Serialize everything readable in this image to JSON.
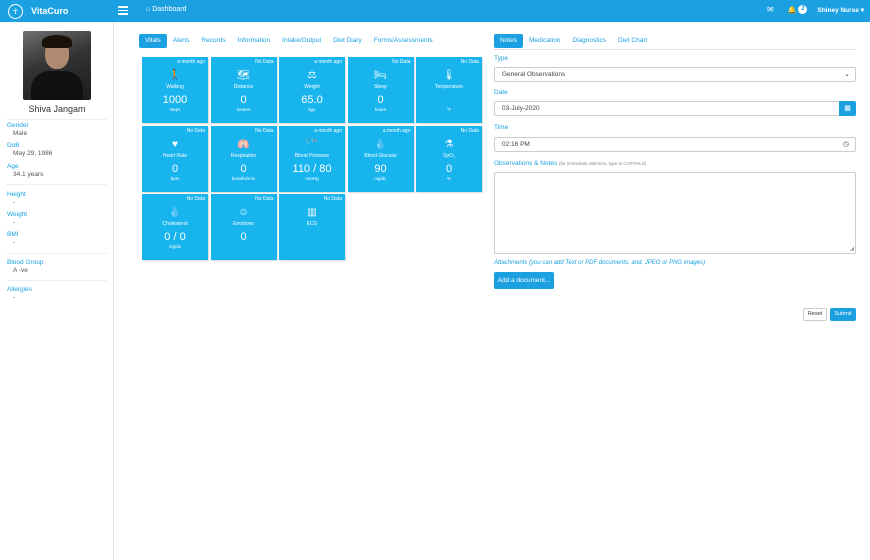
{
  "app": {
    "name": "VitaCuro",
    "logo": "vitacuro-logo-icon"
  },
  "header": {
    "breadcrumb": "Dashboard",
    "notification_count": "2",
    "user": "Shiney Nurse",
    "user_caret": "▾",
    "accent_color": "#1ba1e2"
  },
  "patient": {
    "name": "Shiva Jangam",
    "fields": {
      "gender": {
        "label": "Gender",
        "value": "Male"
      },
      "dob": {
        "label": "DoB",
        "value": "May 29, 1986"
      },
      "age": {
        "label": "Age",
        "value": "34.1 years"
      },
      "height": {
        "label": "Height",
        "value": "-"
      },
      "weight": {
        "label": "Weight",
        "value": "-"
      },
      "bmi": {
        "label": "BMI",
        "value": "-"
      },
      "blood_group": {
        "label": "Blood Group",
        "value": "A -ve"
      },
      "allergies": {
        "label": "Allergies",
        "value": "-"
      }
    }
  },
  "left_tabs": [
    "Vitals",
    "Alerts",
    "Records",
    "Information",
    "Intake/Output",
    "Diet Diary",
    "Forms/Assessments"
  ],
  "tiles": [
    {
      "ago": "a month ago",
      "icon": "walking-icon",
      "glyph": "🚶",
      "name": "Walking",
      "value": "1000",
      "unit": "steps"
    },
    {
      "ago": "No Data",
      "icon": "map-icon",
      "glyph": "🗺",
      "name": "Distance",
      "value": "0",
      "unit": "meters"
    },
    {
      "ago": "a month ago",
      "icon": "weight-icon",
      "glyph": "⚖",
      "name": "Weight",
      "value": "65.0",
      "unit": "kgs"
    },
    {
      "ago": "No Data",
      "icon": "bed-icon",
      "glyph": "🛏",
      "name": "Sleep",
      "value": "0",
      "unit": "hours"
    },
    {
      "ago": "No Data",
      "icon": "thermometer-icon",
      "glyph": "🌡",
      "name": "Temperature",
      "value": "",
      "unit": "°F"
    },
    {
      "ago": "No Data",
      "icon": "heartbeat-icon",
      "glyph": "♥",
      "name": "Heart Rate",
      "value": "0",
      "unit": "bpm"
    },
    {
      "ago": "No Data",
      "icon": "lungs-icon",
      "glyph": "🫁",
      "name": "Respiration",
      "value": "0",
      "unit": "breaths/min"
    },
    {
      "ago": "a month ago",
      "icon": "stethoscope-icon",
      "glyph": "🩺",
      "name": "Blood Pressure",
      "value": "110 / 80",
      "unit": "mmHg"
    },
    {
      "ago": "a month ago",
      "icon": "drop-icon",
      "glyph": "💧",
      "name": "Blood Glucose",
      "value": "90",
      "unit": "mg/dL"
    },
    {
      "ago": "No Data",
      "icon": "oxygen-icon",
      "glyph": "⚗",
      "name": "SpO₂",
      "value": "0",
      "unit": "%"
    },
    {
      "ago": "No Data",
      "icon": "drop-icon",
      "glyph": "💧",
      "name": "Cholesterol",
      "value": "0 / 0",
      "unit": "mg/dL"
    },
    {
      "ago": "No Data",
      "icon": "smile-icon",
      "glyph": "☺",
      "name": "Emotions",
      "value": "0",
      "unit": ""
    },
    {
      "ago": "No Data",
      "icon": "barcode-icon",
      "glyph": "▥",
      "name": "ECG",
      "value": "",
      "unit": ""
    }
  ],
  "right_tabs": [
    "Notes",
    "Medication",
    "Diagnostics",
    "Diet Chart"
  ],
  "form": {
    "type_label": "Type",
    "type_value": "General Observations",
    "date_label": "Date",
    "date_value": "03-July-2020",
    "time_label": "Time",
    "time_value": "02:16 PM",
    "notes_label": "Observations & Notes",
    "notes_hint": "(for immediate attention, type in CAPITALS)",
    "attachments_note": "Attachments (you can add Text or PDF documents, and, JPEG or PNG images)",
    "add_document": "Add a document...",
    "reset": "Reset",
    "submit": "Submit"
  }
}
